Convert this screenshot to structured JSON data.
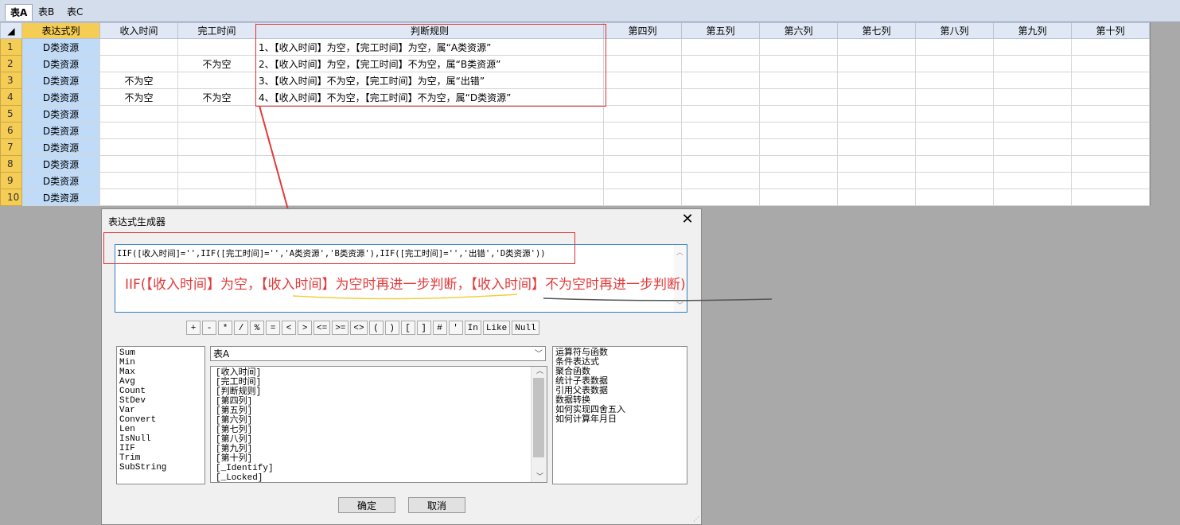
{
  "tabs": [
    "表A",
    "表B",
    "表C"
  ],
  "grid": {
    "columns": [
      "表达式列",
      "收入时间",
      "完工时间",
      "判断规则",
      "第四列",
      "第五列",
      "第六列",
      "第七列",
      "第八列",
      "第九列",
      "第十列"
    ],
    "rows": [
      {
        "n": "1",
        "c1": "D类资源",
        "c2": "",
        "c3": "",
        "rule": "1、【收入时间】为空，【完工时间】为空，属“A类资源”"
      },
      {
        "n": "2",
        "c1": "D类资源",
        "c2": "",
        "c3": "不为空",
        "rule": "2、【收入时间】为空，【完工时间】不为空，属“B类资源”"
      },
      {
        "n": "3",
        "c1": "D类资源",
        "c2": "不为空",
        "c3": "",
        "rule": "3、【收入时间】不为空，【完工时间】为空，属“出错”"
      },
      {
        "n": "4",
        "c1": "D类资源",
        "c2": "不为空",
        "c3": "不为空",
        "rule": "4、【收入时间】不为空，【完工时间】不为空，属“D类资源”"
      },
      {
        "n": "5",
        "c1": "D类资源",
        "c2": "",
        "c3": "",
        "rule": ""
      },
      {
        "n": "6",
        "c1": "D类资源",
        "c2": "",
        "c3": "",
        "rule": ""
      },
      {
        "n": "7",
        "c1": "D类资源",
        "c2": "",
        "c3": "",
        "rule": ""
      },
      {
        "n": "8",
        "c1": "D类资源",
        "c2": "",
        "c3": "",
        "rule": ""
      },
      {
        "n": "9",
        "c1": "D类资源",
        "c2": "",
        "c3": "",
        "rule": ""
      },
      {
        "n": "10",
        "c1": "D类资源",
        "c2": "",
        "c3": "",
        "rule": ""
      }
    ]
  },
  "dialog": {
    "title": "表达式生成器",
    "close_glyph": "✕",
    "expression": "IIF([收入时间]='',IIF([完工时间]='','A类资源','B类资源'),IIF([完工时间]='','出错','D类资源'))",
    "annotation": {
      "p1": "IIF(【收入时间】为空，",
      "p2": "【收入时间】为空时再进一步判断，",
      "p3": "【收入时间】不为空时再进一步判断)"
    },
    "operators": [
      "+",
      "-",
      "*",
      "/",
      "%",
      "=",
      "<",
      ">",
      "<=",
      ">=",
      "<>",
      "(",
      ")",
      "[",
      "]",
      "#",
      "'",
      "In",
      "Like",
      "Null"
    ],
    "functions": [
      "Sum",
      "Min",
      "Max",
      "Avg",
      "Count",
      "StDev",
      "Var",
      "Convert",
      "Len",
      "IsNull",
      "IIF",
      "Trim",
      "SubString"
    ],
    "table_select": "表A",
    "fields": [
      "[收入时间]",
      "[完工时间]",
      "[判断规则]",
      "[第四列]",
      "[第五列]",
      "[第六列]",
      "[第七列]",
      "[第八列]",
      "[第九列]",
      "[第十列]",
      "[_Identify]",
      "[_Locked]"
    ],
    "help": [
      "运算符与函数",
      "条件表达式",
      "聚合函数",
      "统计子表数据",
      "引用父表数据",
      "数据转换",
      "如何实现四舍五入",
      "如何计算年月日"
    ],
    "ok_label": "确定",
    "cancel_label": "取消"
  },
  "colors": {
    "accent_red": "#e23a3a",
    "row_header": "#f5cd55",
    "first_col": "#bfdbf7"
  }
}
